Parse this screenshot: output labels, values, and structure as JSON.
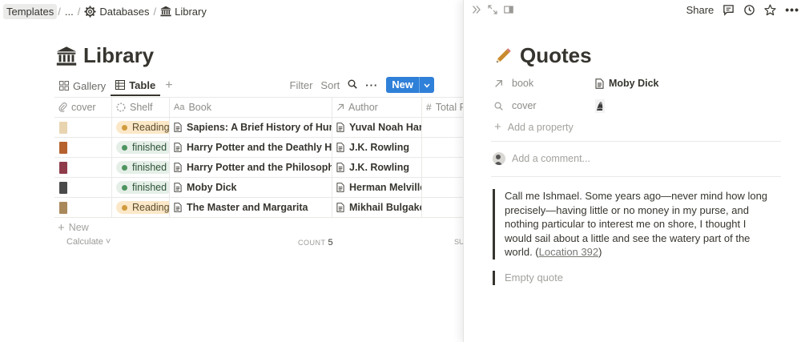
{
  "breadcrumb": {
    "items": [
      "Templates",
      "...",
      "Databases",
      "Library"
    ],
    "separator": "/"
  },
  "page": {
    "title": "Library"
  },
  "views": {
    "tabs": [
      {
        "label": "Gallery",
        "icon": "gallery-icon"
      },
      {
        "label": "Table",
        "icon": "table-icon",
        "active": true
      }
    ],
    "actions": {
      "filter": "Filter",
      "sort": "Sort",
      "new": "New"
    }
  },
  "table": {
    "columns": [
      {
        "label": "cover",
        "icon": "paperclip-icon"
      },
      {
        "label": "Shelf",
        "icon": "status-icon"
      },
      {
        "label": "Book",
        "icon": "text-icon",
        "icon_text": "Aa"
      },
      {
        "label": "Author",
        "icon": "relation-arrow-icon"
      },
      {
        "label": "Total P",
        "icon": "number-icon",
        "icon_text": "#"
      }
    ],
    "rows": [
      {
        "cover_color": "#e9d4b0",
        "shelf": "Reading",
        "book": "Sapiens: A Brief History of Humankind",
        "author": "Yuval Noah Harari"
      },
      {
        "cover_color": "#b5622f",
        "shelf": "finished",
        "book": "Harry Potter and the Deathly Hallows",
        "author": "J.K. Rowling"
      },
      {
        "cover_color": "#8f3b4a",
        "shelf": "finished",
        "book": "Harry Potter and the Philosopher's Stone",
        "author": "J.K. Rowling"
      },
      {
        "cover_color": "#4a4a4a",
        "shelf": "finished",
        "book": "Moby Dick",
        "author": "Herman Melville"
      },
      {
        "cover_color": "#a9885a",
        "shelf": "Reading",
        "book": "The Master and Margarita",
        "author": "Mikhail Bulgakov"
      }
    ],
    "add_row": "New",
    "calculate": "Calculate",
    "count_label": "COUNT",
    "count_value": "5",
    "sum_label": "SU"
  },
  "panel": {
    "share": "Share",
    "title": "Quotes",
    "properties": [
      {
        "name": "book",
        "icon": "relation-arrow-icon",
        "value": "Moby Dick",
        "value_icon": "document-icon"
      },
      {
        "name": "cover",
        "icon": "search-icon",
        "value": "",
        "value_icon": "cover-thumbnail"
      }
    ],
    "add_property": "Add a property",
    "comment_placeholder": "Add a comment...",
    "quote": "Call me Ishmael. Some years ago—never mind how long precisely—having little or no money in my purse, and nothing particular to interest me on shore, I thought I would sail about a little and see the watery part of the world. (",
    "quote_location": "Location 392",
    "quote_end": ")",
    "empty_quote": "Empty quote"
  },
  "colors": {
    "accent": "#2f80d8",
    "text": "#37352f",
    "muted": "#9b9a97",
    "reading_tag": "#fbe8c8",
    "finished_tag": "#e5efe8"
  }
}
